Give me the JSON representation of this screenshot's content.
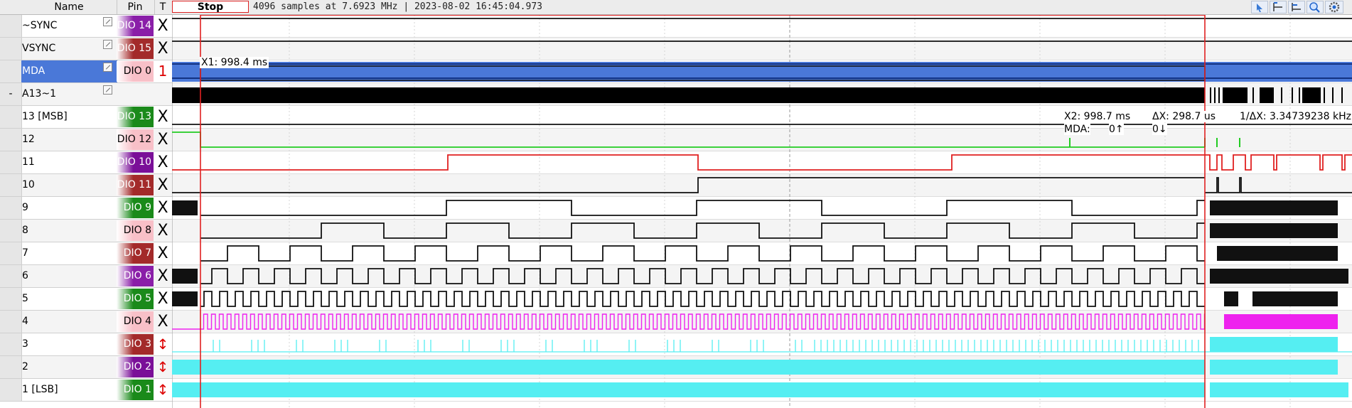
{
  "header": {
    "name_label": "Name",
    "pin_label": "Pin",
    "t_label": "T",
    "stop_label": "Stop",
    "status": "4096 samples at 7.6923 MHz | 2023-08-02 16:45:04.973"
  },
  "toolbar": {
    "tools": [
      {
        "icon": "pointer-icon"
      },
      {
        "icon": "cursor-x1-icon"
      },
      {
        "icon": "cursor-x2-icon"
      },
      {
        "icon": "zoom-icon"
      },
      {
        "icon": "settings-gear-icon"
      }
    ]
  },
  "channels": [
    {
      "name": "~SYNC",
      "pin": "DIO 14",
      "t": "X"
    },
    {
      "name": "VSYNC",
      "pin": "DIO 15",
      "t": "X"
    },
    {
      "name": "MDA",
      "pin": "DIO  0",
      "t": "1"
    },
    {
      "name": "A13~1",
      "pin": "",
      "t": "",
      "expander": "-"
    },
    {
      "name": "13 [MSB]",
      "pin": "DIO 13",
      "t": "X"
    },
    {
      "name": "12",
      "pin": "DIO 12",
      "t": "X"
    },
    {
      "name": "11",
      "pin": "DIO 10",
      "t": "X"
    },
    {
      "name": "10",
      "pin": "DIO 11",
      "t": "X"
    },
    {
      "name": "9",
      "pin": "DIO  9",
      "t": "X"
    },
    {
      "name": "8",
      "pin": "DIO  8",
      "t": "X"
    },
    {
      "name": "7",
      "pin": "DIO  7",
      "t": "X"
    },
    {
      "name": "6",
      "pin": "DIO  6",
      "t": "X"
    },
    {
      "name": "5",
      "pin": "DIO  5",
      "t": "X"
    },
    {
      "name": "4",
      "pin": "DIO  4",
      "t": "X"
    },
    {
      "name": "3",
      "pin": "DIO  3",
      "t": "↕"
    },
    {
      "name": "2",
      "pin": "DIO  2",
      "t": "↕"
    },
    {
      "name": "1 [LSB]",
      "pin": "DIO  1",
      "t": "↕"
    }
  ],
  "pin_colors": [
    "#8a1ea8",
    "#a32a2a",
    "#f8c0c8",
    "",
    "#1a8a1a",
    "#f8c0c8",
    "#7a0f98",
    "#a32a2a",
    "#1a8a1a",
    "#f8c0c8",
    "#a32a2a",
    "#8a1ea8",
    "#1a8a1a",
    "#f8c0c8",
    "#a32a2a",
    "#7a0f98",
    "#1a8a1a"
  ],
  "cursors": {
    "x1_label": "X1: 998.4 ms",
    "x2_label": "X2: 998.7 ms",
    "dx_label": "ΔX: 298.7 us",
    "inv_dx_label": "1/ΔX: 3.34739238 kHz",
    "mda_label": "MDA:",
    "mda_rise": "0↑",
    "mda_fall": "0↓"
  },
  "colors": {
    "cursor": "#e02020",
    "mda_fill": "#4a78d8",
    "trace_black": "#111111",
    "trace_red": "#e02020",
    "trace_green": "#22cc22",
    "trace_magenta": "#ee22ee",
    "trace_cyan": "#55eef2",
    "selection": "#4a78d8"
  }
}
